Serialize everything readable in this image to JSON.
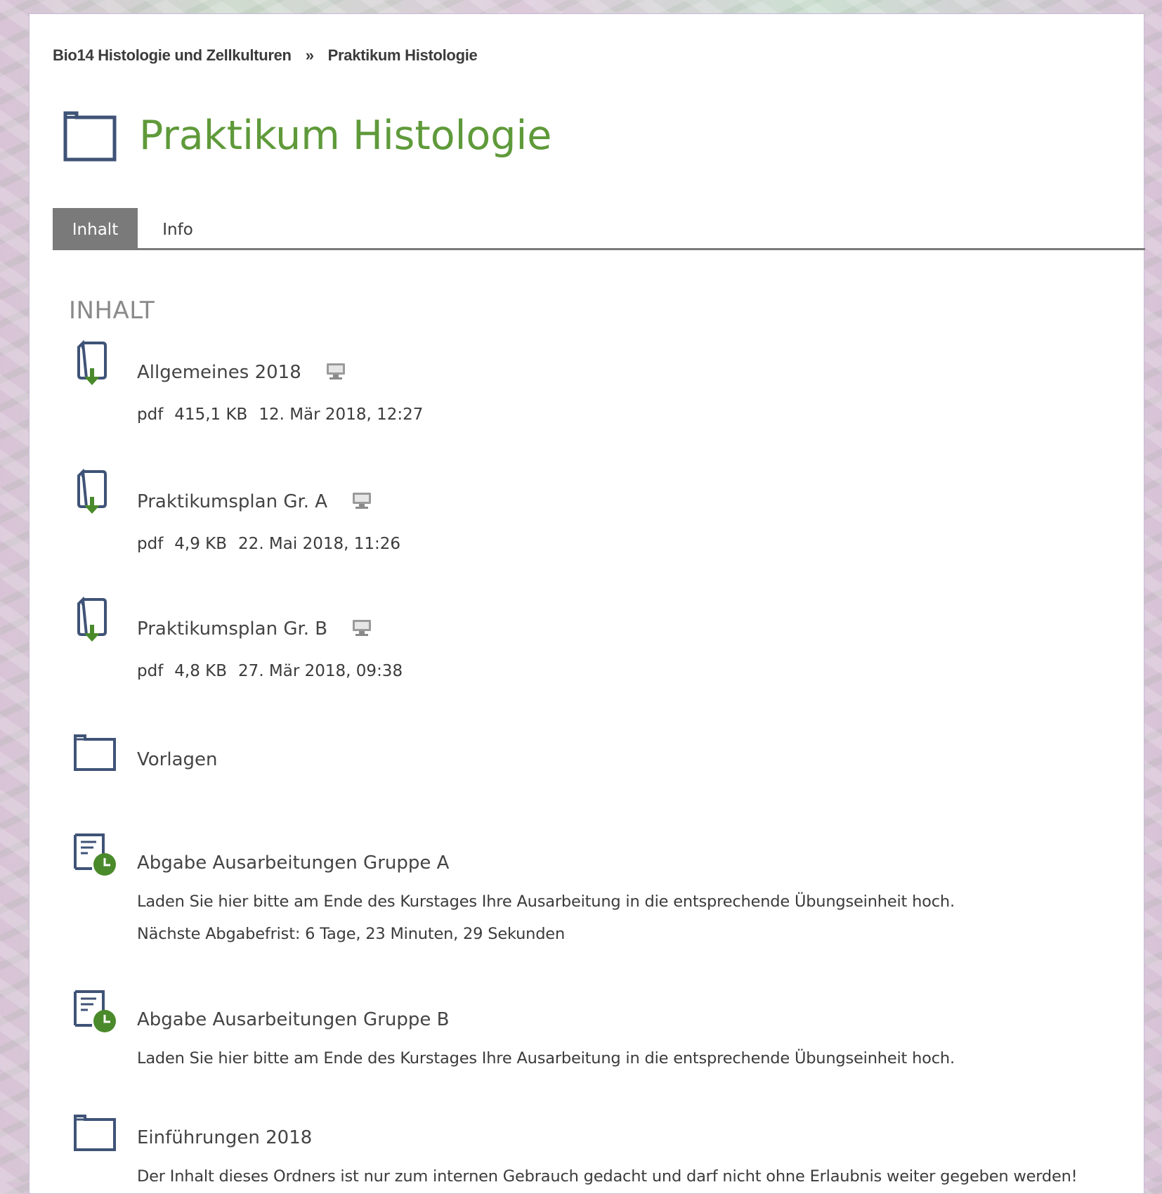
{
  "breadcrumb": {
    "parent": "Bio14 Histologie und Zellkulturen",
    "separator": "»",
    "current": "Praktikum Histologie"
  },
  "page": {
    "title": "Praktikum Histologie"
  },
  "tabs": [
    {
      "label": "Inhalt",
      "active": true
    },
    {
      "label": "Info",
      "active": false
    }
  ],
  "section": {
    "heading": "INHALT"
  },
  "items": [
    {
      "type": "file",
      "icon": "file-download-icon",
      "title": "Allgemeines 2018",
      "format": "pdf",
      "size": "415,1 KB",
      "date": "12. Mär 2018, 12:27"
    },
    {
      "type": "file",
      "icon": "file-download-icon",
      "title": "Praktikumsplan Gr. A",
      "format": "pdf",
      "size": "4,9 KB",
      "date": "22. Mai 2018, 11:26"
    },
    {
      "type": "file",
      "icon": "file-download-icon",
      "title": "Praktikumsplan Gr. B",
      "format": "pdf",
      "size": "4,8 KB",
      "date": "27. Mär 2018, 09:38"
    },
    {
      "type": "folder",
      "icon": "folder-icon",
      "title": "Vorlagen"
    },
    {
      "type": "exercise",
      "icon": "exercise-deadline-icon",
      "title": "Abgabe Ausarbeitungen Gruppe A",
      "description": "Laden Sie hier bitte am Ende des Kurstages Ihre Ausarbeitung in die entsprechende Übungseinheit hoch.",
      "deadline": "Nächste Abgabefrist: 6 Tage, 23 Minuten, 29 Sekunden"
    },
    {
      "type": "exercise",
      "icon": "exercise-deadline-icon",
      "title": "Abgabe Ausarbeitungen Gruppe B",
      "description": "Laden Sie hier bitte am Ende des Kurstages Ihre Ausarbeitung in die entsprechende Übungseinheit hoch."
    },
    {
      "type": "folder",
      "icon": "folder-icon",
      "title": "Einführungen 2018",
      "description": "Der Inhalt dieses Ordners ist nur zum internen Gebrauch gedacht und darf nicht ohne Erlaubnis weiter gegeben werden!"
    }
  ],
  "colors": {
    "title_green": "#5f9a3a",
    "icon_blue": "#3f5377",
    "icon_green": "#4a8a2a",
    "tab_active_bg": "#7a7a7a"
  }
}
